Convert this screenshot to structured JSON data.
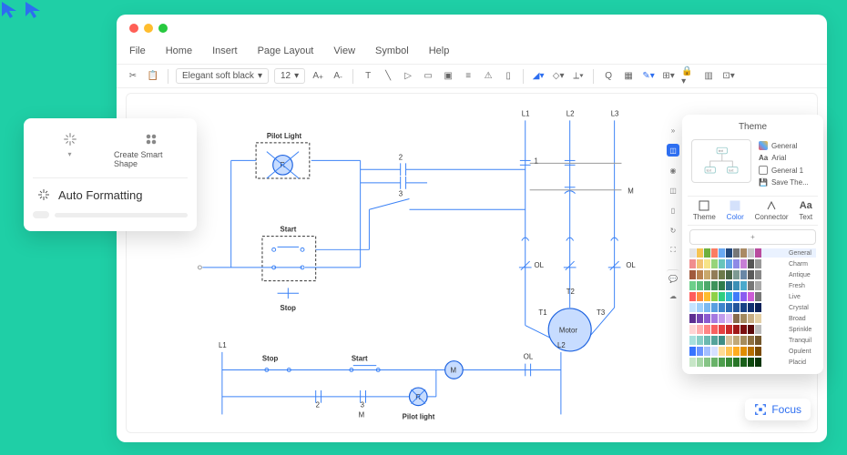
{
  "menu": {
    "file": "File",
    "home": "Home",
    "insert": "Insert",
    "page_layout": "Page Layout",
    "view": "View",
    "symbol": "Symbol",
    "help": "Help"
  },
  "toolbar": {
    "font": "Elegant soft black",
    "size": "12"
  },
  "popup": {
    "smart_shape": "Create Smart Shape",
    "auto_format": "Auto Formatting"
  },
  "circuit": {
    "pilot_light": "Pilot Light",
    "start": "Start",
    "stop": "Stop",
    "motor": "Motor",
    "L1": "L1",
    "L2": "L2",
    "L3": "L3",
    "T1": "T1",
    "T2": "T2",
    "T3": "T3",
    "M": "M",
    "R": "R",
    "OL": "OL",
    "n1": "1",
    "n2": "2",
    "n3": "3",
    "lower_pilot": "Pilot light"
  },
  "theme": {
    "title": "Theme",
    "list": {
      "general": "General",
      "arial": "Arial",
      "general1": "General 1",
      "save": "Save The..."
    },
    "tabs": {
      "theme": "Theme",
      "color": "Color",
      "connector": "Connector",
      "text": "Text"
    },
    "rows": [
      "General",
      "Charm",
      "Antique",
      "Fresh",
      "Live",
      "Crystal",
      "Broad",
      "Sprinkle",
      "Tranquil",
      "Opulent",
      "Placid"
    ],
    "palettes": [
      [
        "#e5e5e5",
        "#f6c453",
        "#6fb03e",
        "#fa7c63",
        "#6aa9f2",
        "#23497d",
        "#777",
        "#aa8a64",
        "#c7c7c7",
        "#b94b9e"
      ],
      [
        "#f08e8e",
        "#f2c375",
        "#f6e388",
        "#96d47a",
        "#66c4bb",
        "#65a6e6",
        "#8e8ae6",
        "#c77fd6",
        "#555555",
        "#999999"
      ],
      [
        "#a15a3e",
        "#b98251",
        "#c9a86c",
        "#927d58",
        "#6d7a4a",
        "#4b6646",
        "#7e9a92",
        "#6987a6",
        "#5a5a5a",
        "#888888"
      ],
      [
        "#6dcf8a",
        "#5bbf7b",
        "#4ca96b",
        "#3e935b",
        "#2f7c4b",
        "#2d6e8f",
        "#3c8fb5",
        "#4ba9cc",
        "#777",
        "#aaa"
      ],
      [
        "#ff5c5c",
        "#ff8c3c",
        "#ffbd2e",
        "#8ed148",
        "#2ecf80",
        "#2eb8cf",
        "#3f7bfa",
        "#8a5cf0",
        "#cc5cd6",
        "#777"
      ],
      [
        "#c5e4ff",
        "#9fd0fa",
        "#7bb9f0",
        "#589fe0",
        "#3e85cc",
        "#2d6db5",
        "#22559c",
        "#194185",
        "#123070",
        "#0b2058"
      ],
      [
        "#5c2e91",
        "#7343b0",
        "#8b5bcf",
        "#a579e0",
        "#c29cec",
        "#dec0f4",
        "#886b4c",
        "#a3895e",
        "#c6ac83",
        "#e4cfa5"
      ],
      [
        "#ffd5d5",
        "#ffb0b0",
        "#ff8585",
        "#f76060",
        "#e54040",
        "#c92a2a",
        "#a01818",
        "#7a0f0f",
        "#5a0a0a",
        "#bbb"
      ],
      [
        "#a8e0de",
        "#88cfc8",
        "#6bb9b1",
        "#54a39a",
        "#3f8d85",
        "#d6c29a",
        "#c0a878",
        "#a68c5c",
        "#8d7042",
        "#73572c"
      ],
      [
        "#3774ff",
        "#6b95ff",
        "#a3bfff",
        "#d6e0ff",
        "#ffdb94",
        "#ffc453",
        "#ffad21",
        "#e08d00",
        "#b56e00",
        "#7a4a00"
      ],
      [
        "#c7e6c7",
        "#a6d6a6",
        "#86c486",
        "#68b268",
        "#4d9e4d",
        "#388a38",
        "#277527",
        "#195f19",
        "#0f490f",
        "#093509"
      ]
    ]
  },
  "focus": {
    "label": "Focus"
  }
}
